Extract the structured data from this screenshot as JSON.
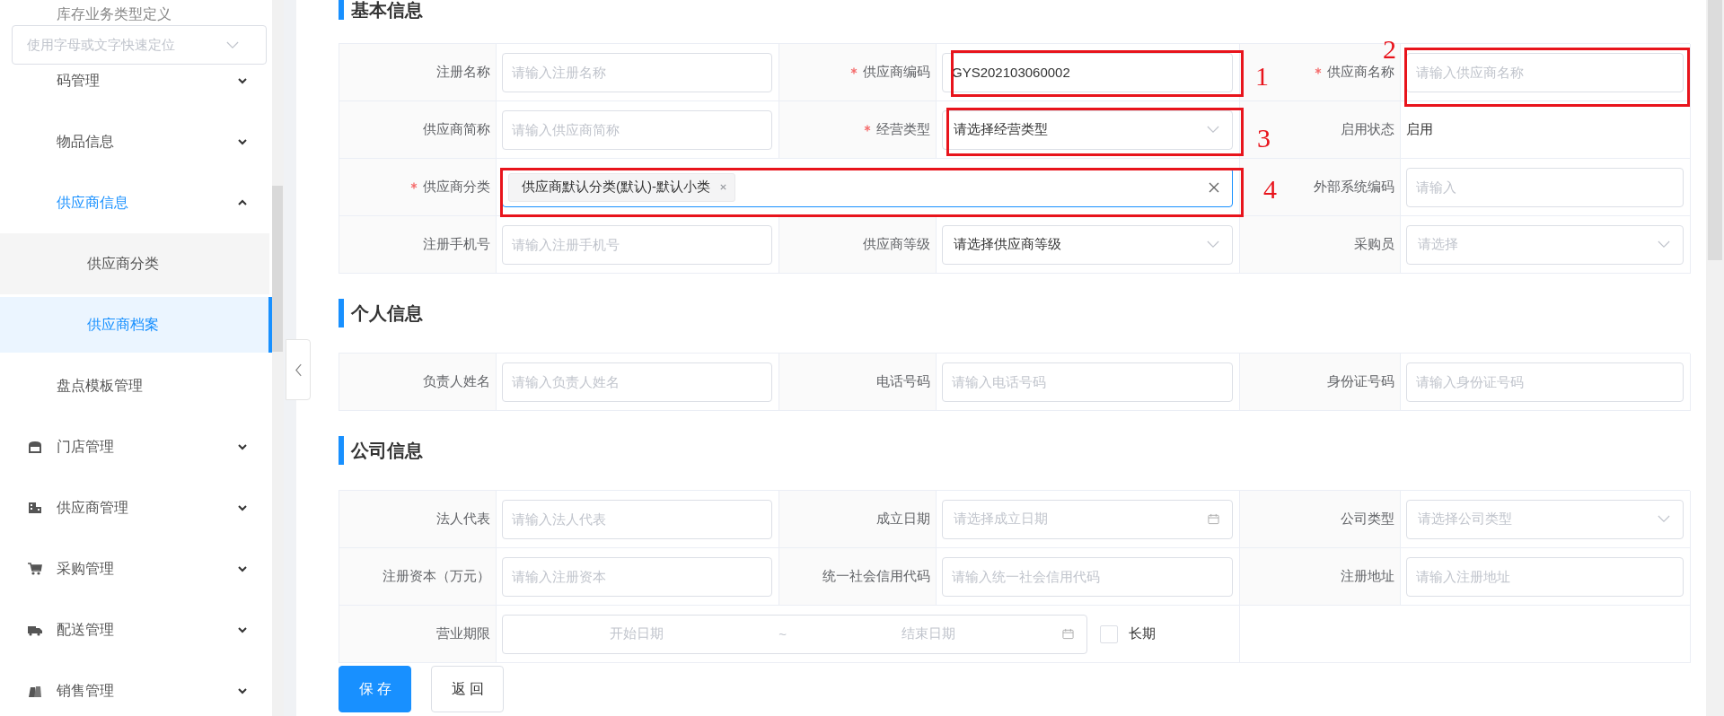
{
  "sidebar": {
    "search": {
      "placeholder": "使用字母或文字快速定位"
    },
    "items": [
      {
        "label": "库存业务类型定义",
        "kind": "page",
        "selected": false
      },
      {
        "label": "码管理",
        "kind": "page",
        "selected": false,
        "expanded": false
      },
      {
        "label": "物品信息",
        "kind": "page",
        "selected": false,
        "expanded": false
      },
      {
        "label": "供应商信息",
        "kind": "page",
        "selected": false,
        "expanded": true,
        "children": [
          {
            "label": "供应商分类",
            "selected": false
          },
          {
            "label": "供应商档案",
            "selected": true
          }
        ]
      },
      {
        "label": "盘点模板管理",
        "kind": "page",
        "selected": false
      },
      {
        "label": "门店管理",
        "kind": "module",
        "selected": false,
        "expanded": false
      },
      {
        "label": "供应商管理",
        "kind": "module",
        "selected": false,
        "expanded": false
      },
      {
        "label": "采购管理",
        "kind": "module",
        "selected": false,
        "expanded": false
      },
      {
        "label": "配送管理",
        "kind": "module",
        "selected": false,
        "expanded": false
      },
      {
        "label": "销售管理",
        "kind": "module",
        "selected": false,
        "expanded": false
      }
    ]
  },
  "sections": [
    {
      "title": "基本信息",
      "rows": [
        [
          {
            "label": "注册名称",
            "required": false,
            "kind": "input",
            "placeholder": "请输入注册名称",
            "focused": false
          },
          {
            "label": "供应商编码",
            "required": true,
            "kind": "input",
            "value": "GYS202103060002",
            "focused": false
          },
          {
            "label": "供应商名称",
            "required": true,
            "kind": "input",
            "placeholder": "请输入供应商名称",
            "focused": false
          }
        ],
        [
          {
            "label": "供应商简称",
            "required": false,
            "kind": "input",
            "placeholder": "请输入供应商简称",
            "focused": false
          },
          {
            "label": "经营类型",
            "required": true,
            "kind": "select",
            "value": "请选择经营类型",
            "focused": false
          },
          {
            "label": "启用状态",
            "required": false,
            "kind": "text",
            "value": "启用"
          }
        ],
        [
          {
            "label": "供应商分类",
            "required": true,
            "kind": "tags",
            "colspan": 3,
            "tags": [
              "供应商默认分类(默认)-默认小类"
            ],
            "focused": true
          },
          {
            "label": "外部系统编码",
            "required": false,
            "kind": "input",
            "placeholder": "请输入",
            "focused": false
          }
        ],
        [
          {
            "label": "注册手机号",
            "required": false,
            "kind": "input",
            "placeholder": "请输入注册手机号",
            "focused": false
          },
          {
            "label": "供应商等级",
            "required": false,
            "kind": "select",
            "value": "请选择供应商等级",
            "focused": false
          },
          {
            "label": "采购员",
            "required": false,
            "kind": "select",
            "placeholder": "请选择",
            "focused": false
          }
        ]
      ]
    },
    {
      "title": "个人信息",
      "rows": [
        [
          {
            "label": "负责人姓名",
            "required": false,
            "kind": "input",
            "placeholder": "请输入负责人姓名",
            "focused": false
          },
          {
            "label": "电话号码",
            "required": false,
            "kind": "input",
            "placeholder": "请输入电话号码",
            "focused": false
          },
          {
            "label": "身份证号码",
            "required": false,
            "kind": "input",
            "placeholder": "请输入身份证号码",
            "focused": false
          }
        ]
      ]
    },
    {
      "title": "公司信息",
      "rows": [
        [
          {
            "label": "法人代表",
            "required": false,
            "kind": "input",
            "placeholder": "请输入法人代表",
            "focused": false
          },
          {
            "label": "成立日期",
            "required": false,
            "kind": "date",
            "placeholder": "请选择成立日期",
            "focused": false
          },
          {
            "label": "公司类型",
            "required": false,
            "kind": "select",
            "placeholder": "请选择公司类型",
            "focused": false
          }
        ],
        [
          {
            "label": "注册资本（万元）",
            "required": false,
            "kind": "input",
            "placeholder": "请输入注册资本",
            "focused": false
          },
          {
            "label": "统一社会信用代码",
            "required": false,
            "kind": "input",
            "placeholder": "请输入统一社会信用代码",
            "focused": false
          },
          {
            "label": "注册地址",
            "required": false,
            "kind": "input",
            "placeholder": "请输入注册地址",
            "focused": false
          }
        ],
        [
          {
            "label": "营业期限",
            "required": false,
            "kind": "daterange",
            "colspan": 3,
            "start_placeholder": "开始日期",
            "separator": "~",
            "end_placeholder": "结束日期",
            "focused": false,
            "checkbox": {
              "label": "长期",
              "checked": false
            }
          }
        ]
      ]
    }
  ],
  "buttons": [
    {
      "label": "保存",
      "kind": "primary"
    },
    {
      "label": "返回",
      "kind": "default"
    }
  ],
  "annotations": [
    {
      "label": "1"
    },
    {
      "label": "2"
    },
    {
      "label": "3"
    },
    {
      "label": "4"
    }
  ]
}
